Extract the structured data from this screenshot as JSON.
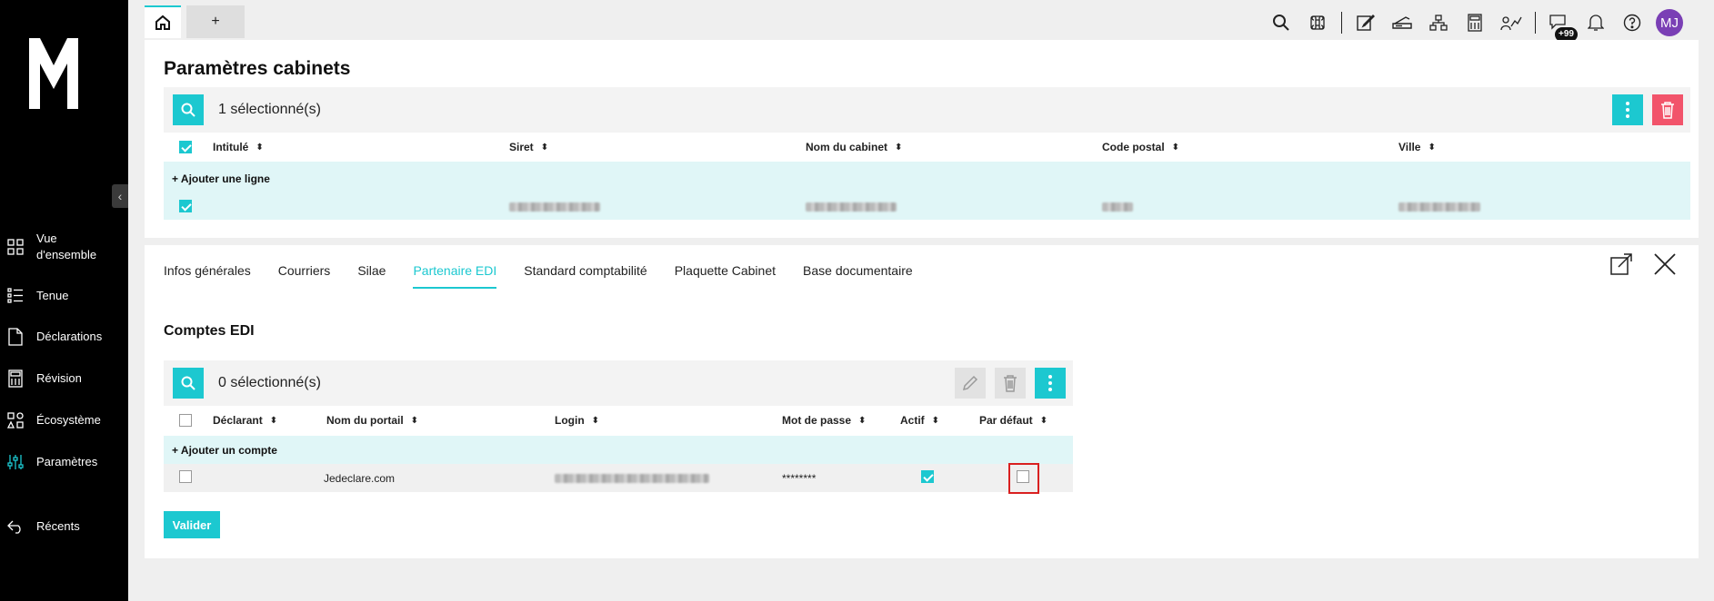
{
  "sidebar": {
    "items": [
      {
        "label": "Vue d'ensemble",
        "icon": "grid-icon"
      },
      {
        "label": "Tenue",
        "icon": "list-icon"
      },
      {
        "label": "Déclarations",
        "icon": "document-icon"
      },
      {
        "label": "Révision",
        "icon": "calculator-icon"
      },
      {
        "label": "Écosystème",
        "icon": "ecosystem-icon"
      },
      {
        "label": "Paramètres",
        "icon": "sliders-icon"
      },
      {
        "label": "Récents",
        "icon": "back-arrow-icon"
      }
    ]
  },
  "topbar": {
    "add_tab": "+",
    "badge": "+99",
    "avatar": "MJ"
  },
  "cabinets": {
    "title": "Paramètres cabinets",
    "selected": "1 sélectionné(s)",
    "columns": [
      "Intitulé",
      "Siret",
      "Nom du cabinet",
      "Code postal",
      "Ville"
    ],
    "add_line": "+ Ajouter une ligne"
  },
  "tabs": [
    "Infos générales",
    "Courriers",
    "Silae",
    "Partenaire EDI",
    "Standard comptabilité",
    "Plaquette Cabinet",
    "Base documentaire"
  ],
  "active_tab": "Partenaire EDI",
  "edi": {
    "title": "Comptes EDI",
    "selected": "0 sélectionné(s)",
    "columns": [
      "Déclarant",
      "Nom du portail",
      "Login",
      "Mot de passe",
      "Actif",
      "Par défaut"
    ],
    "add_account": "+ Ajouter un compte",
    "row": {
      "portal": "Jedeclare.com",
      "password": "********"
    },
    "validate": "Valider"
  },
  "colors": {
    "accent": "#1cc8d0",
    "danger": "#f2546b",
    "highlight": "#d92020",
    "avatar": "#7a3fb5"
  }
}
